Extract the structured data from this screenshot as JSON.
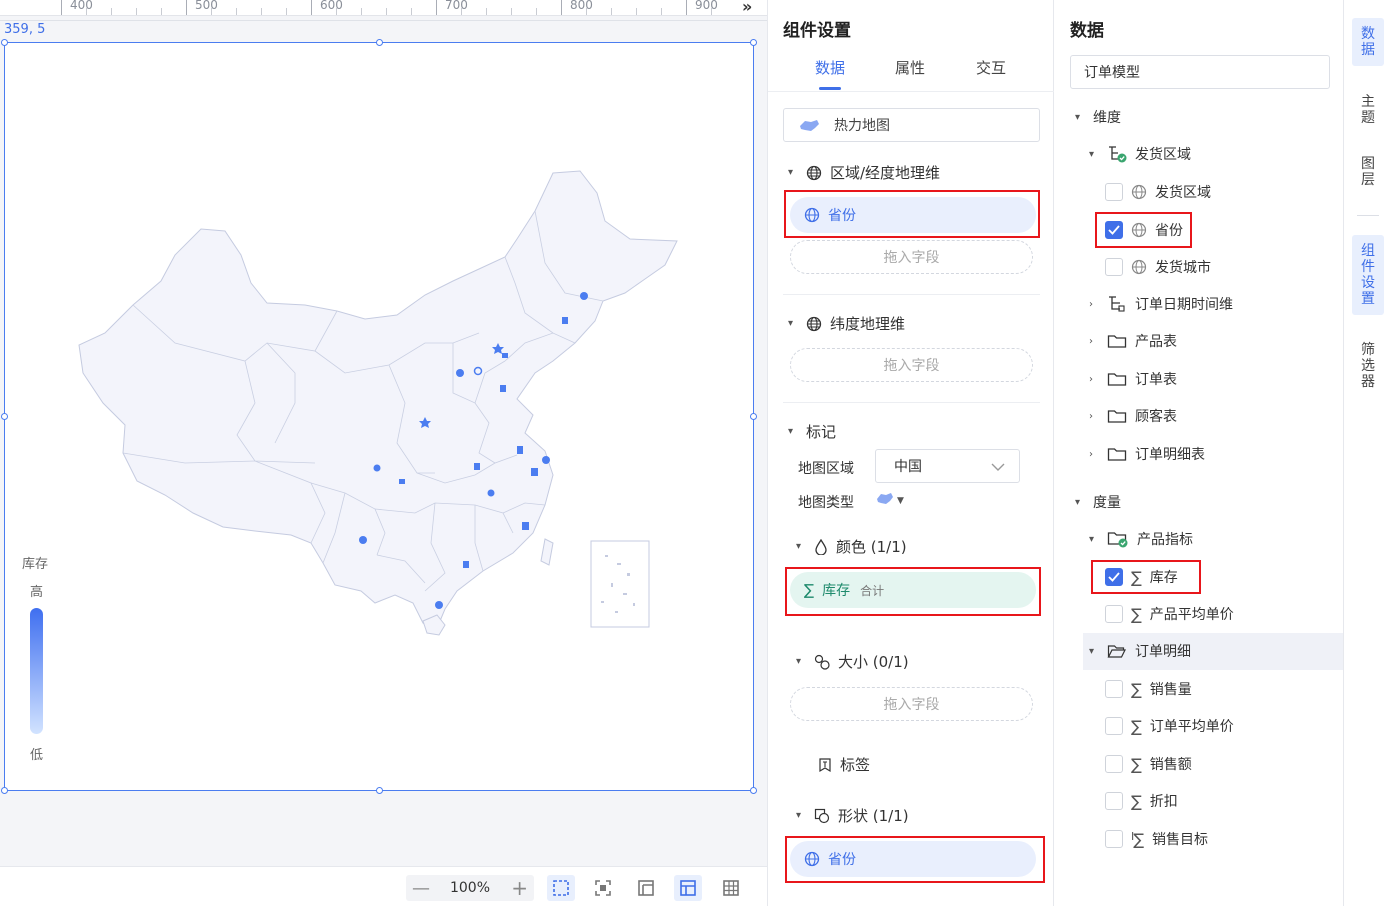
{
  "ruler": {
    "labels": [
      "400",
      "500",
      "600",
      "700",
      "800",
      "900"
    ]
  },
  "canvas": {
    "coords": "359, 5",
    "legend": {
      "title": "库存",
      "high": "高",
      "low": "低",
      "gradient_start": "#3f6ff0",
      "gradient_end": "#d2e3ff"
    },
    "zoom": "100%"
  },
  "settings": {
    "title": "组件设置",
    "tabs": [
      "数据",
      "属性",
      "交互"
    ],
    "chart_type": "热力地图",
    "region_geo": {
      "label": "区域/经度地理维",
      "field": "省份",
      "drop": "拖入字段"
    },
    "lat_geo": {
      "label": "纬度地理维",
      "drop": "拖入字段"
    },
    "marks": {
      "label": "标记",
      "map_region_label": "地图区域",
      "map_region_value": "中国",
      "map_type_label": "地图类型"
    },
    "color": {
      "label": "颜色 (1/1)",
      "field": "库存",
      "agg": "合计"
    },
    "size": {
      "label": "大小 (0/1)",
      "drop": "拖入字段"
    },
    "tag": {
      "label": "标签"
    },
    "shape": {
      "label": "形状 (1/1)",
      "field": "省份"
    }
  },
  "data_panel": {
    "title": "数据",
    "model": "订单模型",
    "dimensions_label": "维度",
    "ship_region": "发货区域",
    "ship_region_items": [
      "发货区域",
      "省份",
      "发货城市"
    ],
    "other_dims": [
      "订单日期时间维",
      "产品表",
      "订单表",
      "顾客表",
      "订单明细表"
    ],
    "measures_label": "度量",
    "product_metrics": "产品指标",
    "product_metric_items": [
      "库存",
      "产品平均单价"
    ],
    "order_detail": "订单明细",
    "order_detail_items": [
      "销售量",
      "订单平均单价",
      "销售额",
      "折扣",
      "销售目标"
    ]
  },
  "rail": [
    "数据",
    "主题",
    "图层",
    "组件设置",
    "筛选器"
  ],
  "colors": {
    "accent": "#3f6fe8",
    "highlight_box": "#e8161b",
    "map_fill": "#f3f4fb",
    "map_stroke": "#c5cbe0"
  }
}
